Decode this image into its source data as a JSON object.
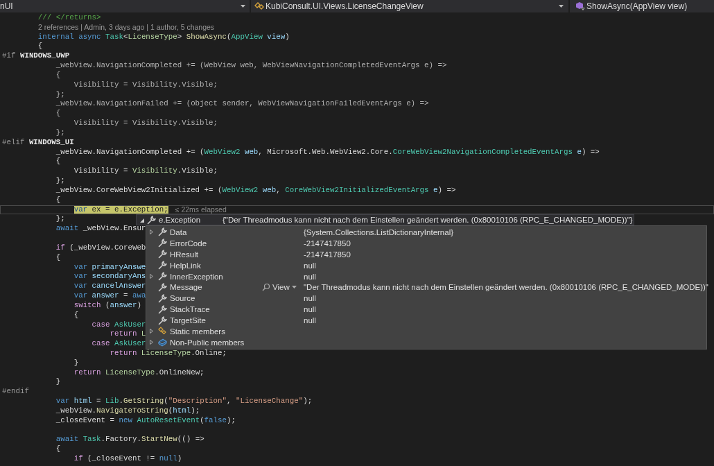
{
  "navigation_bar": {
    "project": "nUI",
    "type": "KubiConsult.UI.Views.LicenseChangeView",
    "member": "ShowAsync(AppView view)"
  },
  "code_lines": [
    {
      "kind": "code",
      "tokens": [
        {
          "text": "        /// </returns>",
          "kind": "comment"
        }
      ]
    },
    {
      "kind": "lens",
      "text": "2 references | Admin, 3 days ago | 1 author, 5 changes"
    },
    {
      "kind": "code",
      "tokens": [
        {
          "text": "        internal async ",
          "kind": "keyword"
        },
        {
          "text": "Task",
          "kind": "type"
        },
        {
          "text": "<",
          "kind": "plain"
        },
        {
          "text": "LicenseType",
          "kind": "enum"
        },
        {
          "text": "> ",
          "kind": "plain"
        },
        {
          "text": "ShowAsync",
          "kind": "method"
        },
        {
          "text": "(",
          "kind": "plain"
        },
        {
          "text": "AppView",
          "kind": "type"
        },
        {
          "text": " view",
          "kind": "variable"
        },
        {
          "text": ")",
          "kind": "plain"
        }
      ]
    },
    {
      "kind": "code",
      "tokens": [
        {
          "text": "        {",
          "kind": "plain"
        }
      ]
    },
    {
      "kind": "code",
      "tokens": [
        {
          "text": "#if ",
          "kind": "directive"
        },
        {
          "text": "WINDOWS_UWP",
          "kind": "symbol"
        }
      ]
    },
    {
      "kind": "code",
      "tokens": [
        {
          "text": "            _webView.NavigationCompleted += (WebView web, WebViewNavigationCompletedEventArgs e) =>",
          "kind": "inactive"
        }
      ]
    },
    {
      "kind": "code",
      "tokens": [
        {
          "text": "            {",
          "kind": "inactive"
        }
      ]
    },
    {
      "kind": "code",
      "tokens": [
        {
          "text": "                Visibility = Visibility.Visible;",
          "kind": "inactive"
        }
      ]
    },
    {
      "kind": "code",
      "tokens": [
        {
          "text": "            };",
          "kind": "inactive"
        }
      ]
    },
    {
      "kind": "code",
      "tokens": [
        {
          "text": "            _webView.NavigationFailed += (object sender, WebViewNavigationFailedEventArgs e) =>",
          "kind": "inactive"
        }
      ]
    },
    {
      "kind": "code",
      "tokens": [
        {
          "text": "            {",
          "kind": "inactive"
        }
      ]
    },
    {
      "kind": "code",
      "tokens": [
        {
          "text": "                Visibility = Visibility.Visible;",
          "kind": "inactive"
        }
      ]
    },
    {
      "kind": "code",
      "tokens": [
        {
          "text": "            };",
          "kind": "inactive"
        }
      ]
    },
    {
      "kind": "code",
      "tokens": [
        {
          "text": "#elif ",
          "kind": "directive"
        },
        {
          "text": "WINDOWS_UI",
          "kind": "symbol"
        }
      ]
    },
    {
      "kind": "code",
      "tokens": [
        {
          "text": "            _webView.NavigationCompleted += (",
          "kind": "plain"
        },
        {
          "text": "WebView2",
          "kind": "type"
        },
        {
          "text": " web",
          "kind": "variable"
        },
        {
          "text": ", Microsoft.Web.WebView2.Core.",
          "kind": "plain"
        },
        {
          "text": "CoreWebView2NavigationCompletedEventArgs",
          "kind": "type"
        },
        {
          "text": " e",
          "kind": "variable"
        },
        {
          "text": ") =>",
          "kind": "plain"
        }
      ]
    },
    {
      "kind": "code",
      "tokens": [
        {
          "text": "            {",
          "kind": "plain"
        }
      ]
    },
    {
      "kind": "code",
      "tokens": [
        {
          "text": "                Visibility = ",
          "kind": "plain"
        },
        {
          "text": "Visibility",
          "kind": "enum"
        },
        {
          "text": ".Visible;",
          "kind": "plain"
        }
      ]
    },
    {
      "kind": "code",
      "tokens": [
        {
          "text": "            };",
          "kind": "plain"
        }
      ]
    },
    {
      "kind": "code",
      "tokens": [
        {
          "text": "            _webView.CoreWebView2Initialized += (",
          "kind": "plain"
        },
        {
          "text": "WebView2",
          "kind": "type"
        },
        {
          "text": " web",
          "kind": "variable"
        },
        {
          "text": ", ",
          "kind": "plain"
        },
        {
          "text": "CoreWebView2InitializedEventArgs",
          "kind": "type"
        },
        {
          "text": " e",
          "kind": "variable"
        },
        {
          "text": ") =>",
          "kind": "plain"
        }
      ]
    },
    {
      "kind": "code",
      "tokens": [
        {
          "text": "            {",
          "kind": "plain"
        }
      ]
    },
    {
      "kind": "current",
      "tokens": [
        {
          "text": "var",
          "kind": "keyword"
        },
        {
          "text": " ex = e.Exception;",
          "kind": "plain"
        }
      ],
      "hint": "≤ 22ms elapsed"
    },
    {
      "kind": "code",
      "tokens": [
        {
          "text": "            };",
          "kind": "plain"
        }
      ]
    },
    {
      "kind": "code",
      "tokens": [
        {
          "text": "            await",
          "kind": "keyword"
        },
        {
          "text": " _webView.Ensur",
          "kind": "plain"
        }
      ]
    },
    {
      "kind": "blank"
    },
    {
      "kind": "code",
      "tokens": [
        {
          "text": "            if",
          "kind": "control"
        },
        {
          "text": " (_webView.CoreWeb",
          "kind": "plain"
        }
      ]
    },
    {
      "kind": "code",
      "tokens": [
        {
          "text": "            {",
          "kind": "plain"
        }
      ]
    },
    {
      "kind": "code",
      "tokens": [
        {
          "text": "                var ",
          "kind": "keyword"
        },
        {
          "text": "primaryAnswe",
          "kind": "variable"
        }
      ]
    },
    {
      "kind": "code",
      "tokens": [
        {
          "text": "                var ",
          "kind": "keyword"
        },
        {
          "text": "secondaryAns",
          "kind": "variable"
        }
      ]
    },
    {
      "kind": "code",
      "tokens": [
        {
          "text": "                var ",
          "kind": "keyword"
        },
        {
          "text": "cancelAnswer",
          "kind": "variable"
        }
      ]
    },
    {
      "kind": "code",
      "tokens": [
        {
          "text": "                var ",
          "kind": "keyword"
        },
        {
          "text": "answer",
          "kind": "variable"
        },
        {
          "text": " = ",
          "kind": "plain"
        },
        {
          "text": "awa",
          "kind": "keyword"
        }
      ]
    },
    {
      "kind": "code",
      "tokens": [
        {
          "text": "                switch",
          "kind": "control"
        },
        {
          "text": " (",
          "kind": "plain"
        },
        {
          "text": "answer",
          "kind": "variable"
        },
        {
          "text": ")",
          "kind": "plain"
        }
      ]
    },
    {
      "kind": "code",
      "tokens": [
        {
          "text": "                {",
          "kind": "plain"
        }
      ]
    },
    {
      "kind": "code",
      "tokens": [
        {
          "text": "                    case ",
          "kind": "control"
        },
        {
          "text": "AskUser",
          "kind": "type"
        }
      ]
    },
    {
      "kind": "code",
      "tokens": [
        {
          "text": "                        return ",
          "kind": "control"
        },
        {
          "text": "L",
          "kind": "enum"
        }
      ]
    },
    {
      "kind": "code",
      "tokens": [
        {
          "text": "                    case ",
          "kind": "control"
        },
        {
          "text": "AskUser",
          "kind": "type"
        }
      ]
    },
    {
      "kind": "code",
      "tokens": [
        {
          "text": "                        return ",
          "kind": "control"
        },
        {
          "text": "LicenseType",
          "kind": "enum"
        },
        {
          "text": ".Online;",
          "kind": "plain"
        }
      ]
    },
    {
      "kind": "code",
      "tokens": [
        {
          "text": "                }",
          "kind": "plain"
        }
      ]
    },
    {
      "kind": "code",
      "tokens": [
        {
          "text": "                return ",
          "kind": "control"
        },
        {
          "text": "LicenseType",
          "kind": "enum"
        },
        {
          "text": ".OnlineNew;",
          "kind": "plain"
        }
      ]
    },
    {
      "kind": "code",
      "tokens": [
        {
          "text": "            }",
          "kind": "plain"
        }
      ]
    },
    {
      "kind": "code",
      "tokens": [
        {
          "text": "#endif",
          "kind": "directive"
        }
      ]
    },
    {
      "kind": "code",
      "tokens": [
        {
          "text": "            var ",
          "kind": "keyword"
        },
        {
          "text": "html",
          "kind": "variable"
        },
        {
          "text": " = ",
          "kind": "plain"
        },
        {
          "text": "Lib",
          "kind": "type"
        },
        {
          "text": ".",
          "kind": "plain"
        },
        {
          "text": "GetString",
          "kind": "method"
        },
        {
          "text": "(",
          "kind": "plain"
        },
        {
          "text": "\"Description\"",
          "kind": "string"
        },
        {
          "text": ", ",
          "kind": "plain"
        },
        {
          "text": "\"LicenseChange\"",
          "kind": "string"
        },
        {
          "text": ");",
          "kind": "plain"
        }
      ]
    },
    {
      "kind": "code",
      "tokens": [
        {
          "text": "            _webView.",
          "kind": "plain"
        },
        {
          "text": "NavigateToString",
          "kind": "method"
        },
        {
          "text": "(",
          "kind": "plain"
        },
        {
          "text": "html",
          "kind": "variable"
        },
        {
          "text": ");",
          "kind": "plain"
        }
      ]
    },
    {
      "kind": "code",
      "tokens": [
        {
          "text": "            _closeEvent = ",
          "kind": "plain"
        },
        {
          "text": "new",
          "kind": "keyword"
        },
        {
          "text": " AutoResetEvent",
          "kind": "type"
        },
        {
          "text": "(",
          "kind": "plain"
        },
        {
          "text": "false",
          "kind": "keyword"
        },
        {
          "text": ");",
          "kind": "plain"
        }
      ]
    },
    {
      "kind": "blank"
    },
    {
      "kind": "code",
      "tokens": [
        {
          "text": "            await",
          "kind": "keyword"
        },
        {
          "text": " Task",
          "kind": "type"
        },
        {
          "text": ".Factory.",
          "kind": "plain"
        },
        {
          "text": "StartNew",
          "kind": "method"
        },
        {
          "text": "(() =>",
          "kind": "plain"
        }
      ]
    },
    {
      "kind": "code",
      "tokens": [
        {
          "text": "            {",
          "kind": "plain"
        }
      ]
    },
    {
      "kind": "code",
      "tokens": [
        {
          "text": "                if",
          "kind": "control"
        },
        {
          "text": " (_closeEvent != ",
          "kind": "plain"
        },
        {
          "text": "null",
          "kind": "keyword"
        },
        {
          "text": ")",
          "kind": "plain"
        }
      ]
    }
  ],
  "datatip": {
    "expression": "e.Exception",
    "value": "{\"Der Threadmodus kann nicht nach dem Einstellen geändert werden. (0x80010106 (RPC_E_CHANGED_MODE))\"}",
    "expanded": true,
    "members": [
      {
        "kind": "property",
        "name": "Data",
        "value": "{System.Collections.ListDictionaryInternal}",
        "expandable": true
      },
      {
        "kind": "property",
        "name": "ErrorCode",
        "value": "-2147417850",
        "expandable": false
      },
      {
        "kind": "property",
        "name": "HResult",
        "value": "-2147417850",
        "expandable": false
      },
      {
        "kind": "property",
        "name": "HelpLink",
        "value": "null",
        "expandable": false
      },
      {
        "kind": "property",
        "name": "InnerException",
        "value": "null",
        "expandable": true
      },
      {
        "kind": "property",
        "name": "Message",
        "value": "\"Der Threadmodus kann nicht nach dem Einstellen geändert werden. (0x80010106 (RPC_E_CHANGED_MODE))\"",
        "viewer": "View",
        "expandable": false
      },
      {
        "kind": "property",
        "name": "Source",
        "value": "null",
        "expandable": false
      },
      {
        "kind": "property",
        "name": "StackTrace",
        "value": "null",
        "expandable": false
      },
      {
        "kind": "property",
        "name": "TargetSite",
        "value": "null",
        "expandable": false
      },
      {
        "kind": "static",
        "name": "Static members",
        "expandable": true
      },
      {
        "kind": "nonpublic",
        "name": "Non-Public members",
        "expandable": true
      }
    ]
  }
}
